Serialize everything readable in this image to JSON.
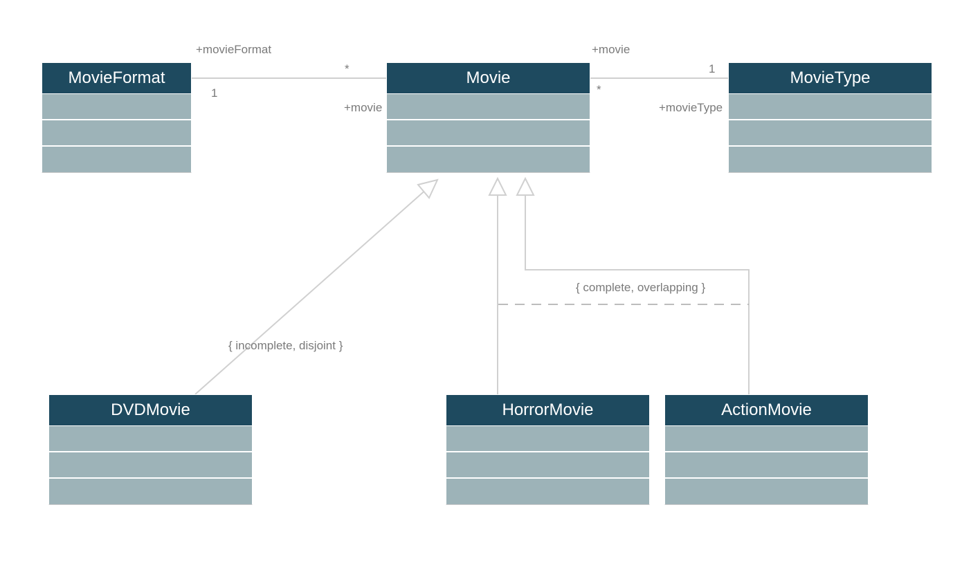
{
  "classes": {
    "movieFormat": {
      "title": "MovieFormat"
    },
    "movie": {
      "title": "Movie"
    },
    "movieType": {
      "title": "MovieType"
    },
    "dvdMovie": {
      "title": "DVDMovie"
    },
    "horrorMovie": {
      "title": "HorrorMovie"
    },
    "actionMovie": {
      "title": "ActionMovie"
    }
  },
  "labels": {
    "role_movieFormat": "+movieFormat",
    "role_movie_left": "+movie",
    "role_movie_right": "+movie",
    "role_movieType": "+movieType",
    "mult_star_left": "*",
    "mult_one_left": "1",
    "mult_one_right": "1",
    "mult_star_right": "*"
  },
  "constraints": {
    "left": "{ incomplete, disjoint }",
    "right": "{ complete, overlapping }"
  }
}
